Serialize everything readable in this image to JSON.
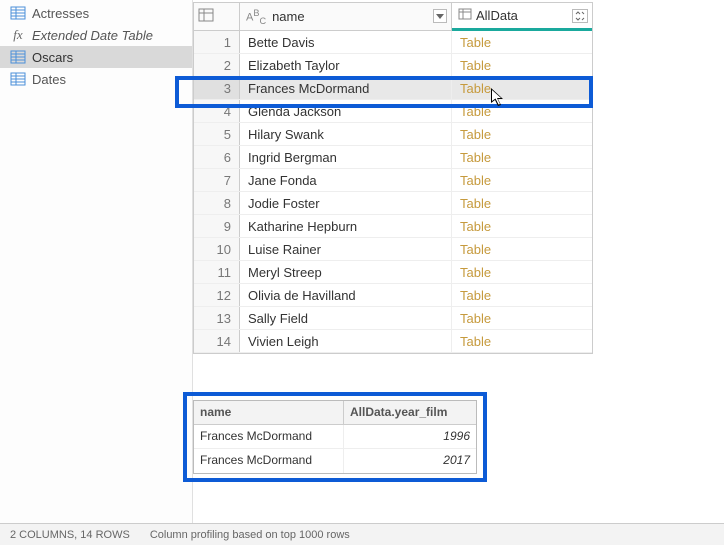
{
  "sidebar": {
    "items": [
      {
        "label": "Actresses",
        "icon": "table",
        "italic": false,
        "selected": false
      },
      {
        "label": "Extended Date Table",
        "icon": "fx",
        "italic": true,
        "selected": false
      },
      {
        "label": "Oscars",
        "icon": "table",
        "italic": false,
        "selected": true
      },
      {
        "label": "Dates",
        "icon": "table",
        "italic": false,
        "selected": false
      }
    ]
  },
  "grid": {
    "columns": {
      "name": "name",
      "alldata": "AllData"
    },
    "table_value": "Table",
    "rows": [
      {
        "idx": 1,
        "name": "Bette Davis"
      },
      {
        "idx": 2,
        "name": "Elizabeth Taylor"
      },
      {
        "idx": 3,
        "name": "Frances McDormand"
      },
      {
        "idx": 4,
        "name": "Glenda Jackson"
      },
      {
        "idx": 5,
        "name": "Hilary Swank"
      },
      {
        "idx": 6,
        "name": "Ingrid Bergman"
      },
      {
        "idx": 7,
        "name": "Jane Fonda"
      },
      {
        "idx": 8,
        "name": "Jodie Foster"
      },
      {
        "idx": 9,
        "name": "Katharine Hepburn"
      },
      {
        "idx": 10,
        "name": "Luise Rainer"
      },
      {
        "idx": 11,
        "name": "Meryl Streep"
      },
      {
        "idx": 12,
        "name": "Olivia de Havilland"
      },
      {
        "idx": 13,
        "name": "Sally Field"
      },
      {
        "idx": 14,
        "name": "Vivien Leigh"
      }
    ],
    "selected_index": 3
  },
  "detail": {
    "headers": {
      "name": "name",
      "year": "AllData.year_film"
    },
    "rows": [
      {
        "name": "Frances McDormand",
        "year": "1996"
      },
      {
        "name": "Frances McDormand",
        "year": "2017"
      }
    ]
  },
  "status": {
    "cols_rows": "2 COLUMNS, 14 ROWS",
    "profiling": "Column profiling based on top 1000 rows"
  }
}
